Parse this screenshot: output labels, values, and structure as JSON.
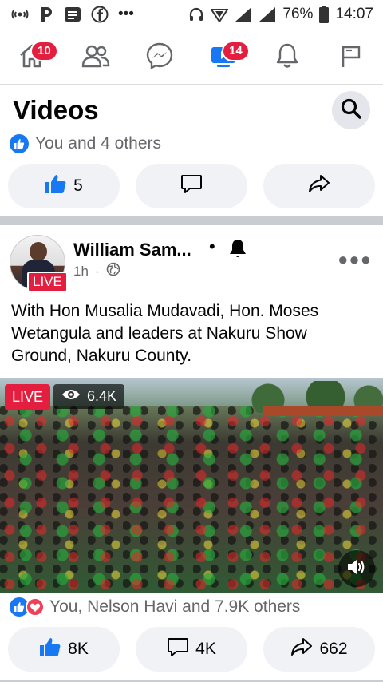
{
  "status_bar": {
    "icons": [
      "signal-wave-icon",
      "p-app-icon",
      "news-icon",
      "facebook-icon",
      "more-dots-icon",
      "headphones-icon",
      "vpn-icon",
      "cell-signal-icon",
      "cell-signal-icon",
      "battery-icon"
    ],
    "more": "•••",
    "battery": "76%",
    "time": "14:07"
  },
  "nav": {
    "items": [
      {
        "name": "home",
        "icon": "home-icon",
        "badge": "10"
      },
      {
        "name": "friends",
        "icon": "friends-icon",
        "badge": ""
      },
      {
        "name": "messenger",
        "icon": "messenger-icon",
        "badge": ""
      },
      {
        "name": "watch",
        "icon": "watch-icon",
        "badge": "14"
      },
      {
        "name": "notifications",
        "icon": "bell-icon",
        "badge": ""
      },
      {
        "name": "pages",
        "icon": "flag-icon",
        "badge": ""
      }
    ],
    "active_color": "#1877f2"
  },
  "videos": {
    "title": "Videos",
    "reactions_text": "You and 4 others",
    "actions": {
      "like_count": "5"
    }
  },
  "post": {
    "author": "William Sam...",
    "live_tag": "LIVE",
    "dot": "•",
    "time": "1h",
    "text": "With Hon Musalia  Mudavadi, Hon. Moses Wetangula and leaders at Nakuru Show Ground, Nakuru County.",
    "video": {
      "live_label": "LIVE",
      "views": "6.4K"
    },
    "reactions_text": "You, Nelson Havi and 7.9K others",
    "actions": {
      "likes": "8K",
      "comments": "4K",
      "shares": "662"
    }
  },
  "colors": {
    "brand": "#1877f2",
    "badge": "#e41e3f",
    "love": "#f33e58",
    "secondary_text": "#65676b",
    "pill_bg": "#f0f2f5"
  }
}
